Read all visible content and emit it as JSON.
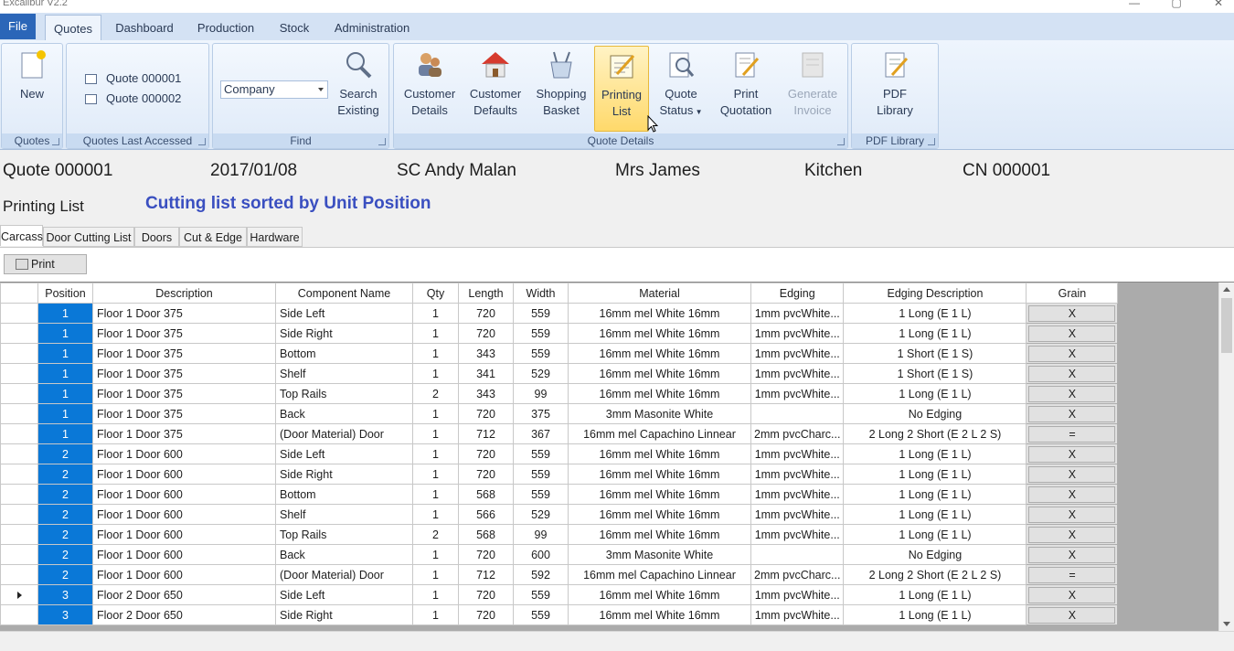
{
  "app": {
    "title": "Excalibur V2.2"
  },
  "menu": {
    "file": "File",
    "tabs": [
      "Quotes",
      "Dashboard",
      "Production",
      "Stock",
      "Administration"
    ]
  },
  "ribbon": {
    "quotes_group": {
      "label": "Quotes",
      "new_label": "New"
    },
    "last_accessed": {
      "label": "Quotes Last Accessed",
      "items": [
        "Quote 000001",
        "Quote 000002"
      ]
    },
    "find": {
      "label": "Find",
      "combo_value": "Company",
      "search_l1": "Search",
      "search_l2": "Existing"
    },
    "quote_details": {
      "label": "Quote Details",
      "buttons": [
        {
          "l1": "Customer",
          "l2": "Details"
        },
        {
          "l1": "Customer",
          "l2": "Defaults"
        },
        {
          "l1": "Shopping",
          "l2": "Basket"
        },
        {
          "l1": "Printing",
          "l2": "List"
        },
        {
          "l1": "Quote",
          "l2": "Status"
        },
        {
          "l1": "Print",
          "l2": "Quotation"
        },
        {
          "l1": "Generate",
          "l2": "Invoice"
        }
      ]
    },
    "pdf": {
      "label": "PDF Library",
      "l1": "PDF",
      "l2": "Library"
    }
  },
  "info": {
    "quote": "Quote 000001",
    "date": "2017/01/08",
    "rep": "SC Andy Malan",
    "customer": "Mrs James",
    "room": "Kitchen",
    "cn": "CN 000001"
  },
  "page": {
    "subtitle": "Printing List",
    "cutting_title": "Cutting list sorted by Unit Position",
    "tabs": [
      "Carcass",
      "Door Cutting List",
      "Doors",
      "Cut & Edge",
      "Hardware"
    ],
    "print_label": "Print"
  },
  "grid": {
    "columns": [
      "Position",
      "Description",
      "Component Name",
      "Qty",
      "Length",
      "Width",
      "Material",
      "Edging",
      "Edging Description",
      "Grain"
    ],
    "rows": [
      [
        "1",
        "Floor 1 Door 375",
        "Side Left",
        "1",
        "720",
        "559",
        "16mm mel White 16mm",
        "1mm pvcWhite...",
        "1 Long (E 1 L)",
        "X"
      ],
      [
        "1",
        "Floor 1 Door 375",
        "Side Right",
        "1",
        "720",
        "559",
        "16mm mel White 16mm",
        "1mm pvcWhite...",
        "1 Long (E 1 L)",
        "X"
      ],
      [
        "1",
        "Floor 1 Door 375",
        "Bottom",
        "1",
        "343",
        "559",
        "16mm mel White 16mm",
        "1mm pvcWhite...",
        "1 Short (E 1 S)",
        "X"
      ],
      [
        "1",
        "Floor 1 Door 375",
        "Shelf",
        "1",
        "341",
        "529",
        "16mm mel White 16mm",
        "1mm pvcWhite...",
        "1 Short (E 1 S)",
        "X"
      ],
      [
        "1",
        "Floor 1 Door 375",
        "Top Rails",
        "2",
        "343",
        "99",
        "16mm mel White 16mm",
        "1mm pvcWhite...",
        "1 Long (E 1 L)",
        "X"
      ],
      [
        "1",
        "Floor 1 Door 375",
        "Back",
        "1",
        "720",
        "375",
        "3mm Masonite White",
        "",
        "No Edging",
        "X"
      ],
      [
        "1",
        "Floor 1 Door 375",
        "(Door Material) Door",
        "1",
        "712",
        "367",
        "16mm mel Capachino Linnear",
        "2mm pvcCharc...",
        "2 Long 2 Short (E 2 L 2 S)",
        "="
      ],
      [
        "2",
        "Floor 1 Door 600",
        "Side Left",
        "1",
        "720",
        "559",
        "16mm mel White 16mm",
        "1mm pvcWhite...",
        "1 Long (E 1 L)",
        "X"
      ],
      [
        "2",
        "Floor 1 Door 600",
        "Side Right",
        "1",
        "720",
        "559",
        "16mm mel White 16mm",
        "1mm pvcWhite...",
        "1 Long (E 1 L)",
        "X"
      ],
      [
        "2",
        "Floor 1 Door 600",
        "Bottom",
        "1",
        "568",
        "559",
        "16mm mel White 16mm",
        "1mm pvcWhite...",
        "1 Long (E 1 L)",
        "X"
      ],
      [
        "2",
        "Floor 1 Door 600",
        "Shelf",
        "1",
        "566",
        "529",
        "16mm mel White 16mm",
        "1mm pvcWhite...",
        "1 Long (E 1 L)",
        "X"
      ],
      [
        "2",
        "Floor 1 Door 600",
        "Top Rails",
        "2",
        "568",
        "99",
        "16mm mel White 16mm",
        "1mm pvcWhite...",
        "1 Long (E 1 L)",
        "X"
      ],
      [
        "2",
        "Floor 1 Door 600",
        "Back",
        "1",
        "720",
        "600",
        "3mm Masonite White",
        "",
        "No Edging",
        "X"
      ],
      [
        "2",
        "Floor 1 Door 600",
        "(Door Material) Door",
        "1",
        "712",
        "592",
        "16mm mel Capachino Linnear",
        "2mm pvcCharc...",
        "2 Long 2 Short (E 2 L 2 S)",
        "="
      ],
      [
        "3",
        "Floor 2 Door 650",
        "Side Left",
        "1",
        "720",
        "559",
        "16mm mel White 16mm",
        "1mm pvcWhite...",
        "1 Long (E 1 L)",
        "X"
      ],
      [
        "3",
        "Floor 2 Door 650",
        "Side Right",
        "1",
        "720",
        "559",
        "16mm mel White 16mm",
        "1mm pvcWhite...",
        "1 Long (E 1 L)",
        "X"
      ]
    ],
    "current_row": 14
  },
  "colors": {
    "accent": "#2b66b8",
    "selection": "#0a78d7",
    "title_blue": "#3a4fc0"
  }
}
